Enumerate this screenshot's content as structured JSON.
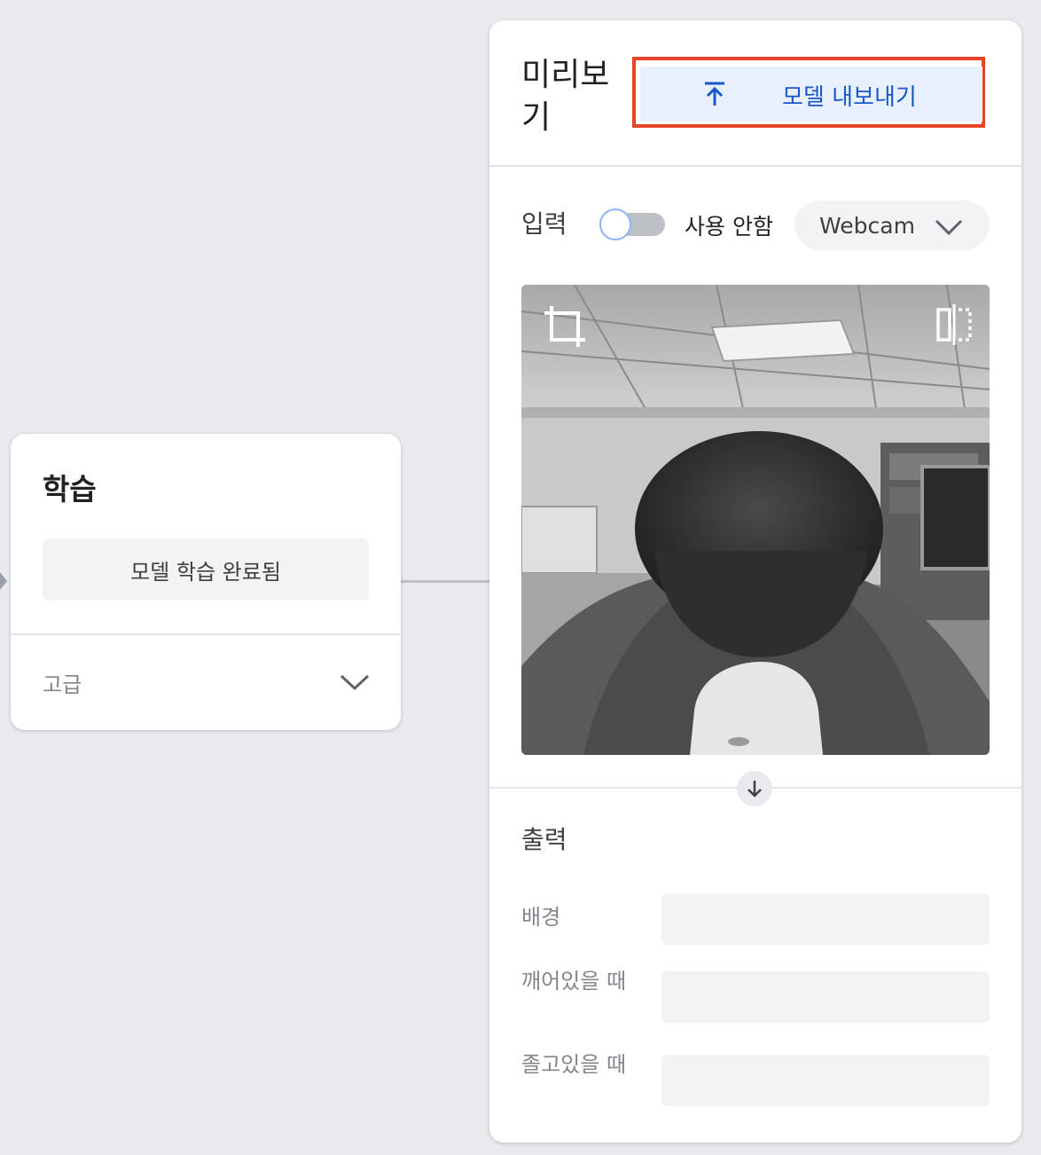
{
  "training": {
    "title": "학습",
    "train_button": "모델 학습 완료됨",
    "advanced_label": "고급"
  },
  "preview": {
    "title": "미리보기",
    "export_button": "모델 내보내기",
    "input_label": "입력",
    "toggle_label": "사용 안함",
    "toggle_on": false,
    "source_select": "Webcam",
    "output_label": "출력",
    "classes": [
      {
        "name": "배경",
        "confidence": null
      },
      {
        "name": "깨어있을 때",
        "confidence": null
      },
      {
        "name": "졸고있을 때",
        "confidence": null
      }
    ]
  },
  "colors": {
    "page_bg": "#e8eaed",
    "export_bg": "#e8f0fe",
    "export_text": "#1a57c8",
    "highlight_border": "#e8442a"
  }
}
